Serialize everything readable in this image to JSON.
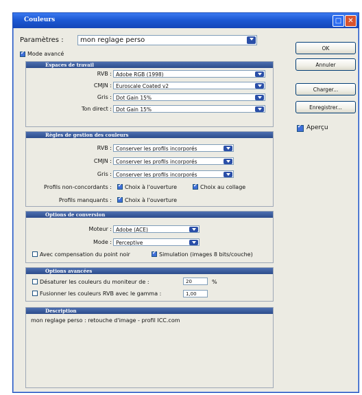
{
  "window": {
    "title": "Couleurs"
  },
  "params": {
    "label": "Paramètres :",
    "value": "mon reglage perso"
  },
  "advanced_mode": {
    "label": "Mode avancé",
    "checked": true
  },
  "workspaces": {
    "title": "Espaces de travail",
    "rgb_label": "RVB :",
    "rgb_value": "Adobe RGB (1998)",
    "cmyk_label": "CMJN :",
    "cmyk_value": "Euroscale Coated v2",
    "gray_label": "Gris :",
    "gray_value": "Dot Gain 15%",
    "spot_label": "Ton direct :",
    "spot_value": "Dot Gain 15%"
  },
  "policies": {
    "title": "Règles de gestion des couleurs",
    "rgb_label": "RVB :",
    "rgb_value": "Conserver les profils incorporés",
    "cmyk_label": "CMJN :",
    "cmyk_value": "Conserver les profils incorporés",
    "gray_label": "Gris :",
    "gray_value": "Conserver les profils incorporés",
    "mismatch_label": "Profils non-concordants :",
    "mismatch_open": "Choix à l'ouverture",
    "mismatch_paste": "Choix au collage",
    "missing_label": "Profils manquants :",
    "missing_open": "Choix à l'ouverture"
  },
  "conversion": {
    "title": "Options de conversion",
    "engine_label": "Moteur :",
    "engine_value": "Adobe (ACE)",
    "intent_label": "Mode :",
    "intent_value": "Perceptive",
    "bpc_label": "Avec compensation du point noir",
    "dither_label": "Simulation (images 8 bits/couche)"
  },
  "advanced": {
    "title": "Options avancées",
    "desaturate_label": "Désaturer les couleurs du moniteur de :",
    "desaturate_value": "20",
    "percent": "%",
    "blend_label": "Fusionner les couleurs RVB avec le gamma :",
    "blend_value": "1,00"
  },
  "description": {
    "title": "Description",
    "text": "mon reglage perso : retouche d'image - profil ICC.com"
  },
  "buttons": {
    "ok": "OK",
    "cancel": "Annuler",
    "load": "Charger...",
    "save": "Enregistrer...",
    "preview": "Aperçu"
  },
  "colors": {
    "titlebar": "#1d59d4",
    "section_header": "#2c4c8c",
    "dialog_bg": "#ecebe3"
  }
}
